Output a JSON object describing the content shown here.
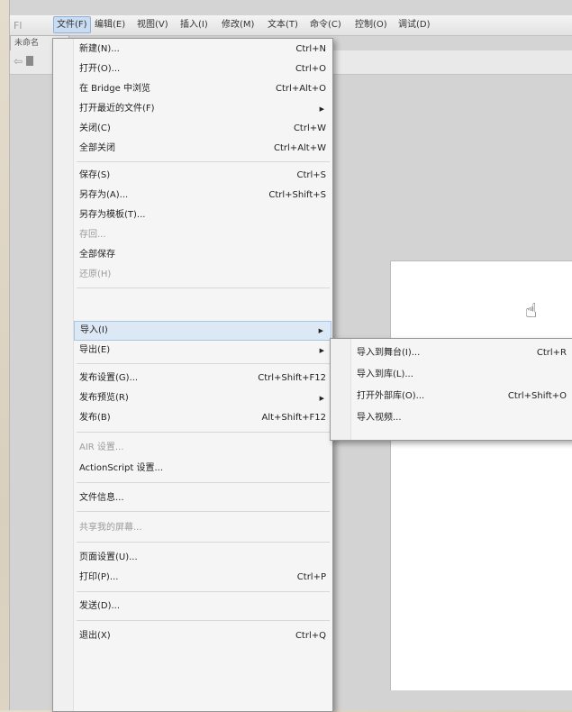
{
  "app": {
    "logo": "Fl"
  },
  "menubar": {
    "items": [
      {
        "label": "文件(F)",
        "active": true
      },
      {
        "label": "编辑(E)"
      },
      {
        "label": "视图(V)"
      },
      {
        "label": "插入(I)"
      },
      {
        "label": "修改(M)"
      },
      {
        "label": "文本(T)"
      },
      {
        "label": "命令(C)"
      },
      {
        "label": "控制(O)"
      },
      {
        "label": "调试(D)"
      }
    ]
  },
  "doc_tab": {
    "label": "未命名"
  },
  "file_menu": {
    "items": [
      {
        "label": "新建(N)...",
        "shortcut": "Ctrl+N"
      },
      {
        "label": "打开(O)...",
        "shortcut": "Ctrl+O"
      },
      {
        "label": "在 Bridge 中浏览",
        "shortcut": "Ctrl+Alt+O"
      },
      {
        "label": "打开最近的文件(F)",
        "submenu": true
      },
      {
        "label": "关闭(C)",
        "shortcut": "Ctrl+W"
      },
      {
        "label": "全部关闭",
        "shortcut": "Ctrl+Alt+W"
      },
      {
        "label": "保存(S)",
        "shortcut": "Ctrl+S"
      },
      {
        "label": "另存为(A)...",
        "shortcut": "Ctrl+Shift+S"
      },
      {
        "label": "另存为模板(T)..."
      },
      {
        "label": "存回...",
        "disabled": true
      },
      {
        "label": "全部保存"
      },
      {
        "label": "还原(H)",
        "disabled": true
      },
      {
        "label": "导入(I)",
        "submenu": true,
        "highlighted": true
      },
      {
        "label": "导出(E)",
        "submenu": true
      },
      {
        "label": "发布设置(G)...",
        "shortcut": "Ctrl+Shift+F12"
      },
      {
        "label": "发布预览(R)",
        "submenu": true
      },
      {
        "label": "发布(B)",
        "shortcut": "Alt+Shift+F12"
      },
      {
        "label": "AIR 设置...",
        "disabled": true
      },
      {
        "label": "ActionScript 设置..."
      },
      {
        "label": "文件信息..."
      },
      {
        "label": "共享我的屏幕...",
        "disabled": true
      },
      {
        "label": "页面设置(U)..."
      },
      {
        "label": "打印(P)...",
        "shortcut": "Ctrl+P"
      },
      {
        "label": "发送(D)..."
      },
      {
        "label": "退出(X)",
        "shortcut": "Ctrl+Q"
      }
    ]
  },
  "import_submenu": {
    "items": [
      {
        "label": "导入到舞台(I)...",
        "shortcut": "Ctrl+R"
      },
      {
        "label": "导入到库(L)..."
      },
      {
        "label": "打开外部库(O)...",
        "shortcut": "Ctrl+Shift+O"
      },
      {
        "label": "导入视频..."
      }
    ]
  },
  "icons": {
    "cursor": "hand-cursor-icon",
    "submenu_arrow": "triangle-right-icon",
    "back": "back-arrow-icon",
    "scene": "scene-icon"
  }
}
